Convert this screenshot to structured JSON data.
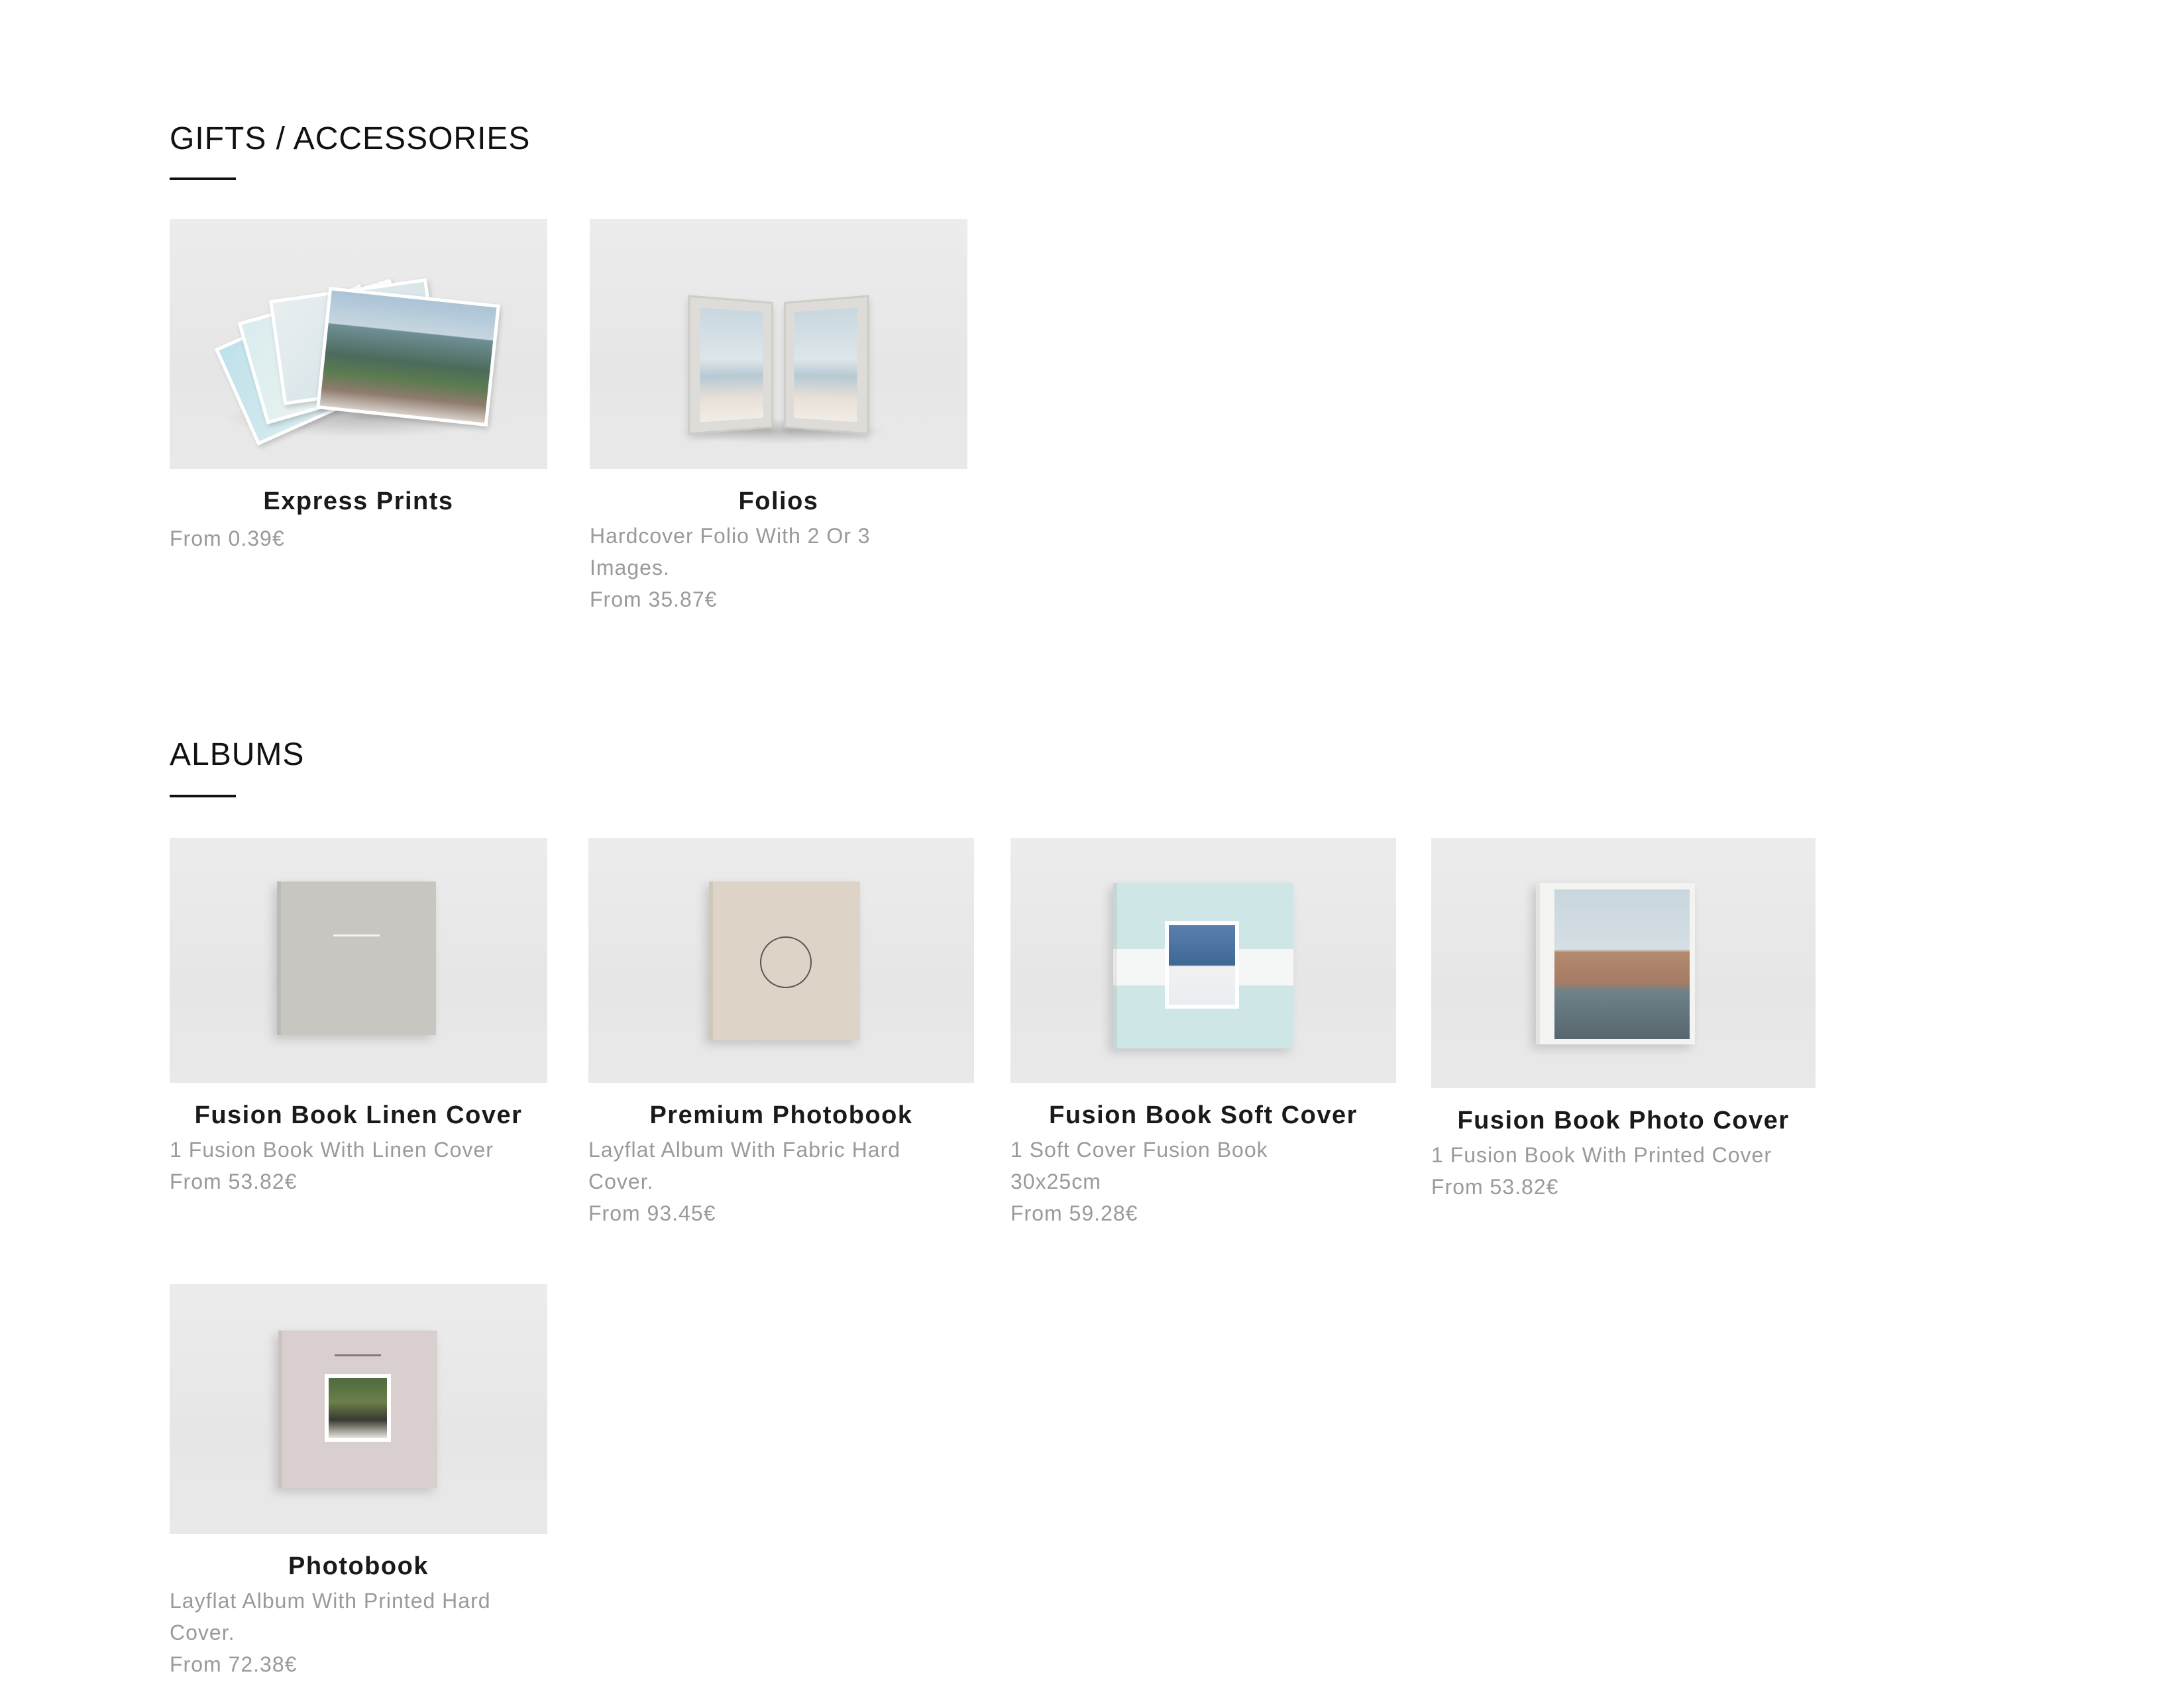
{
  "sections": [
    {
      "title": "GIFTS / ACCESSORIES",
      "products": [
        {
          "name": "Express Prints",
          "description": "",
          "price": "From 0.39€",
          "thumb_icon": "fanned-prints-image"
        },
        {
          "name": "Folios",
          "description": "Hardcover Folio With 2 Or 3 Images.",
          "price": "From 35.87€",
          "thumb_icon": "folio-image"
        }
      ]
    },
    {
      "title": "ALBUMS",
      "products": [
        {
          "name": "Fusion Book Linen Cover",
          "description": "1 Fusion Book With Linen Cover",
          "price": "From 53.82€",
          "thumb_icon": "linen-book-image"
        },
        {
          "name": "Premium Photobook",
          "description": "Layflat Album With Fabric Hard Cover.",
          "price": "From 93.45€",
          "thumb_icon": "fabric-book-image"
        },
        {
          "name": "Fusion Book Soft Cover",
          "description": "1 Soft Cover Fusion Book 30x25cm",
          "price": "From 59.28€",
          "thumb_icon": "soft-cover-book-image"
        },
        {
          "name": "Fusion Book Photo Cover",
          "description": "1 Fusion Book With Printed Cover",
          "price": "From 53.82€",
          "thumb_icon": "photo-cover-book-image"
        },
        {
          "name": "Photobook",
          "description": "Layflat Album With Printed Hard Cover.",
          "price": "From 72.38€",
          "thumb_icon": "printed-book-image"
        }
      ]
    }
  ],
  "colors": {
    "heading": "#111111",
    "product_name": "#1a1a1a",
    "muted_text": "#9a9a9a",
    "thumb_background": "#e8e8e8",
    "linen_cover": "#c8c6c1",
    "fabric_cover": "#ddd3c6",
    "soft_cover": "#cfe6e6",
    "photobook_cover": "#d9cfcf"
  }
}
